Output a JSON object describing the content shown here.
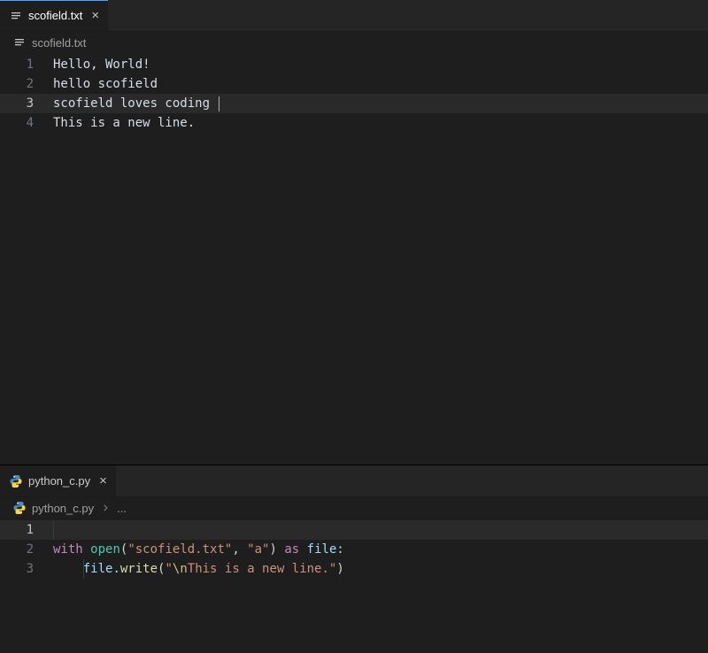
{
  "top_pane": {
    "tab": {
      "filename": "scofield.txt",
      "icon": "text-file-icon"
    },
    "breadcrumb": {
      "filename": "scofield.txt",
      "icon": "text-file-icon"
    },
    "lines": [
      {
        "num": "1",
        "text": "Hello, World!"
      },
      {
        "num": "2",
        "text": "hello scofield"
      },
      {
        "num": "3",
        "text": "scofield loves coding ",
        "current": true,
        "cursor": true
      },
      {
        "num": "4",
        "text": "This is a new line."
      }
    ]
  },
  "bottom_pane": {
    "tab": {
      "filename": "python_c.py",
      "icon": "python-file-icon"
    },
    "breadcrumb": {
      "filename": "python_c.py",
      "icon": "python-file-icon",
      "extra": "..."
    },
    "code": {
      "line1_num": "1",
      "line2_num": "2",
      "line3_num": "3",
      "kw_with": "with",
      "fn_open": "open",
      "str_filename": "\"scofield.txt\"",
      "str_mode": "\"a\"",
      "kw_as": "as",
      "var_file": "file",
      "fn_write": "write",
      "str_prefix": "\"",
      "str_escape": "\\n",
      "str_rest": "This is a new line.\""
    }
  }
}
